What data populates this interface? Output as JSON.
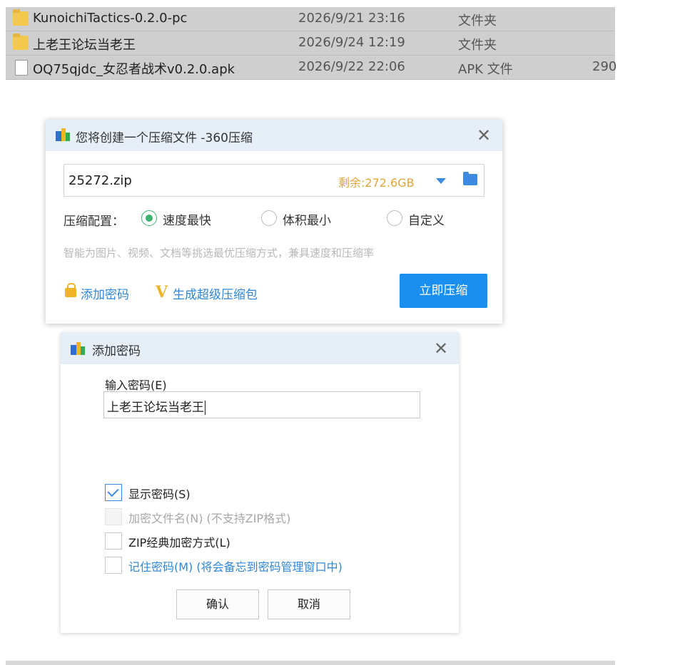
{
  "file_list": [
    {
      "icon": "folder-icon",
      "name": "KunoichiTactics-0.2.0-pc",
      "date": "2026/9/21 23:16",
      "type": "文件夹",
      "size": ""
    },
    {
      "icon": "folder-icon",
      "name": "上老王论坛当老王",
      "date": "2026/9/24 12:19",
      "type": "文件夹",
      "size": ""
    },
    {
      "icon": "file-icon",
      "name": "OQ75qjdc_女忍者战术v0.2.0.apk",
      "date": "2026/9/22 22:06",
      "type": "APK 文件",
      "size": "290"
    }
  ],
  "compress_dialog": {
    "title": "您将创建一个压缩文件 -360压缩",
    "close_label": "✕",
    "filename": "25272.zip",
    "remaining": "剩余:272.6GB",
    "config_label": "压缩配置：",
    "options": [
      {
        "label": "速度最快",
        "selected": true
      },
      {
        "label": "体积最小",
        "selected": false
      },
      {
        "label": "自定义",
        "selected": false
      }
    ],
    "hint": "智能为图片、视频、文档等挑选最优压缩方式，兼具速度和压缩率",
    "add_password_link": "添加密码",
    "vip_mark": "V",
    "super_pack_link": "生成超级压缩包",
    "compress_button": "立即压缩"
  },
  "password_dialog": {
    "title": "添加密码",
    "close_label": "✕",
    "input_label": "输入密码(E)",
    "password_value": "上老王论坛当老王",
    "checkboxes": [
      {
        "label": "显示密码(S)",
        "checked": true,
        "disabled": false
      },
      {
        "label": "加密文件名(N) (不支持ZIP格式)",
        "checked": false,
        "disabled": true
      },
      {
        "label": "ZIP经典加密方式(L)",
        "checked": false,
        "disabled": false
      },
      {
        "label": "记住密码(M) (将会备忘到密码管理窗口中)",
        "checked": false,
        "disabled": false
      }
    ],
    "ok_button": "确认",
    "cancel_button": "取消"
  }
}
